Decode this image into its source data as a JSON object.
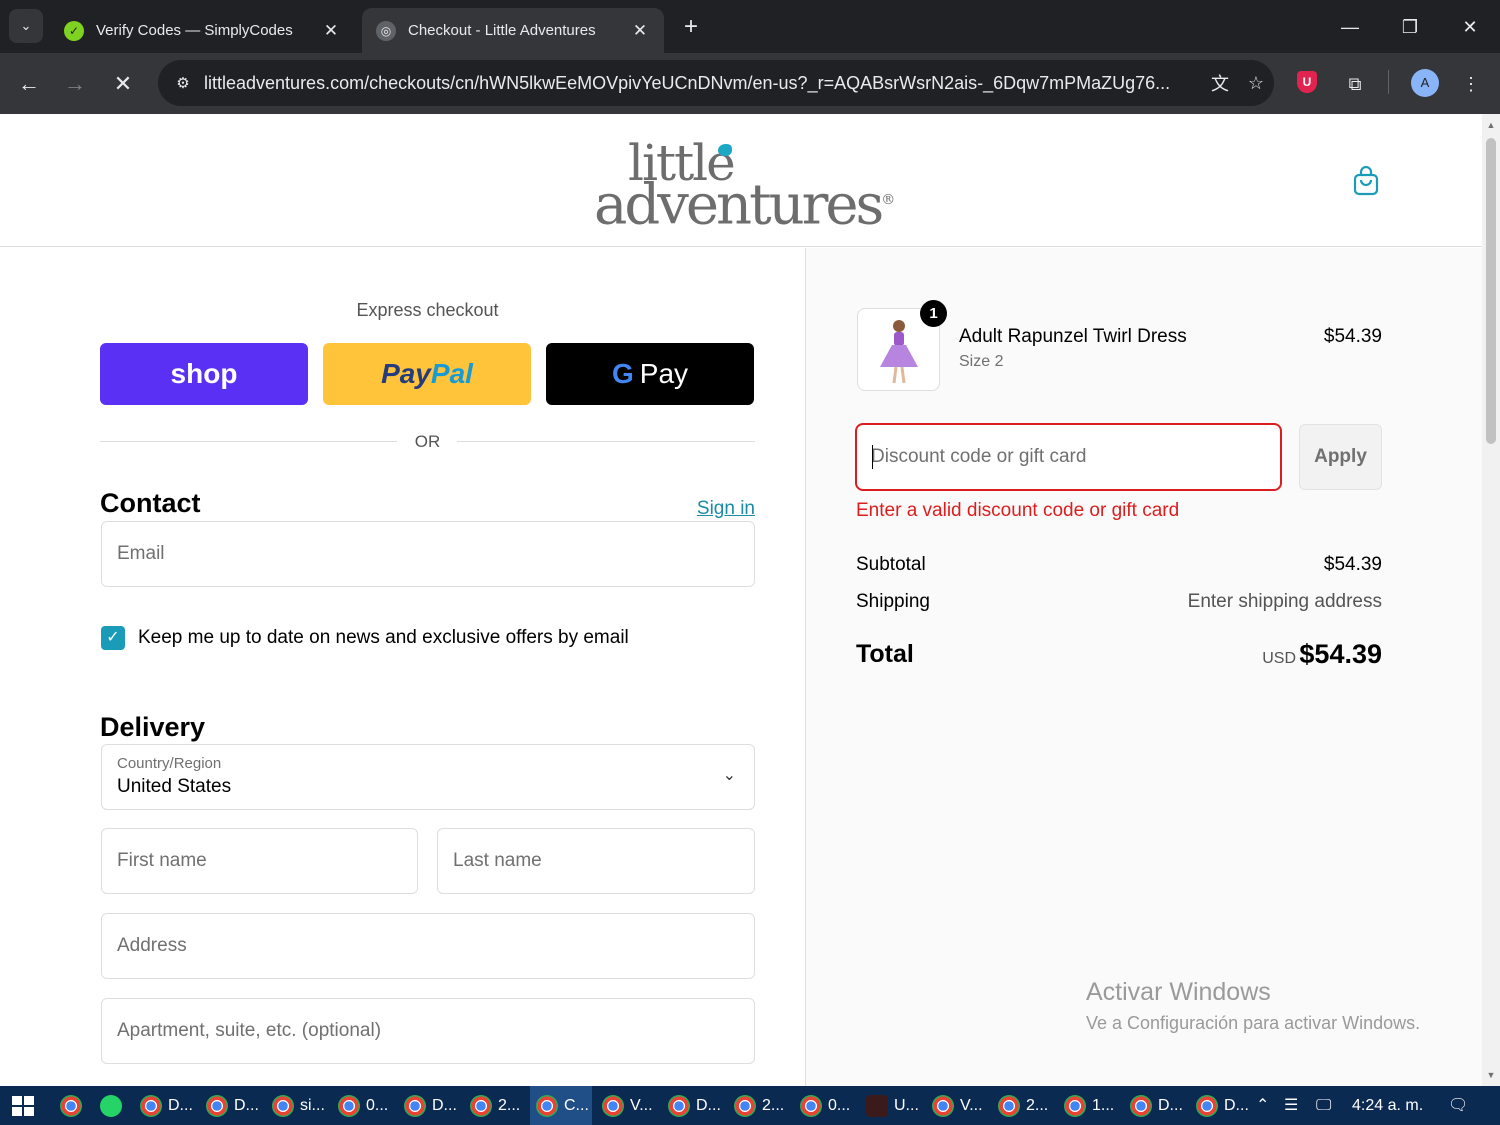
{
  "browser": {
    "tabs": [
      {
        "title": "Verify Codes — SimplyCodes",
        "close": "✕"
      },
      {
        "title": "Checkout - Little Adventures",
        "close": "✕"
      }
    ],
    "new_tab": "+",
    "url": "littleadventures.com/checkouts/cn/hWN5lkwEeMOVpivYeUCnDNvm/en-us?_r=AQABsrWsrN2ais-_6Dqw7mPMaZUg76...",
    "profile_initial": "A",
    "extension_badge": "U"
  },
  "header": {
    "logo_line1": "little",
    "logo_line2": "adventures",
    "logo_mark": "®"
  },
  "express": {
    "label": "Express checkout",
    "shop_label": "shop",
    "paypal_pay": "Pay",
    "paypal_pal": "Pal",
    "gpay_g": "G",
    "gpay_label": "Pay",
    "or": "OR"
  },
  "contact": {
    "title": "Contact",
    "sign_in": "Sign in",
    "email_placeholder": "Email",
    "newsletter_label": "Keep me up to date on news and exclusive offers by email",
    "newsletter_checked": true
  },
  "delivery": {
    "title": "Delivery",
    "country_label": "Country/Region",
    "country_value": "United States",
    "first_name_placeholder": "First name",
    "last_name_placeholder": "Last name",
    "address_placeholder": "Address",
    "apartment_placeholder": "Apartment, suite, etc. (optional)"
  },
  "order": {
    "item": {
      "quantity": "1",
      "name": "Adult Rapunzel Twirl Dress",
      "variant": "Size 2",
      "price": "$54.39"
    },
    "discount_placeholder": "Discount code or gift card",
    "apply_label": "Apply",
    "error": "Enter a valid discount code or gift card",
    "subtotal_label": "Subtotal",
    "subtotal_value": "$54.39",
    "shipping_label": "Shipping",
    "shipping_value": "Enter shipping address",
    "total_label": "Total",
    "total_currency": "USD",
    "total_value": "$54.39"
  },
  "watermark": {
    "line1": "Activar Windows",
    "line2": "Ve a Configuración para activar Windows."
  },
  "taskbar": {
    "items": [
      "D...",
      "D...",
      "si...",
      "0...",
      "D...",
      "2...",
      "C...",
      "V...",
      "D...",
      "2...",
      "0...",
      "U...",
      "V...",
      "2...",
      "1...",
      "D...",
      "D..."
    ],
    "clock": "4:24 a. m."
  }
}
